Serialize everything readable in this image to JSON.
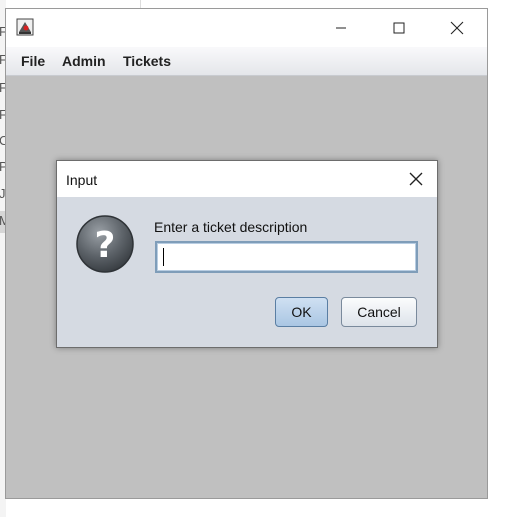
{
  "background": {
    "left_edge_chars": [
      "F",
      "F",
      "F",
      "F",
      "C",
      "P",
      "J",
      "M"
    ]
  },
  "window": {
    "app_icon": "java-app-icon",
    "controls": {
      "minimize_icon": "minimize-icon",
      "maximize_icon": "maximize-icon",
      "close_icon": "close-icon"
    },
    "menu": [
      "File",
      "Admin",
      "Tickets"
    ]
  },
  "dialog": {
    "title": "Input",
    "close_icon": "close-icon",
    "message_icon": "question-icon",
    "prompt": "Enter a ticket description",
    "input_value": "",
    "ok_label": "OK",
    "cancel_label": "Cancel"
  },
  "colors": {
    "desktop_gray": "#c0c0c0",
    "dialog_bg": "#d5dae2",
    "input_border": "#7f9db9",
    "ok_button_top": "#cfe0f2"
  }
}
